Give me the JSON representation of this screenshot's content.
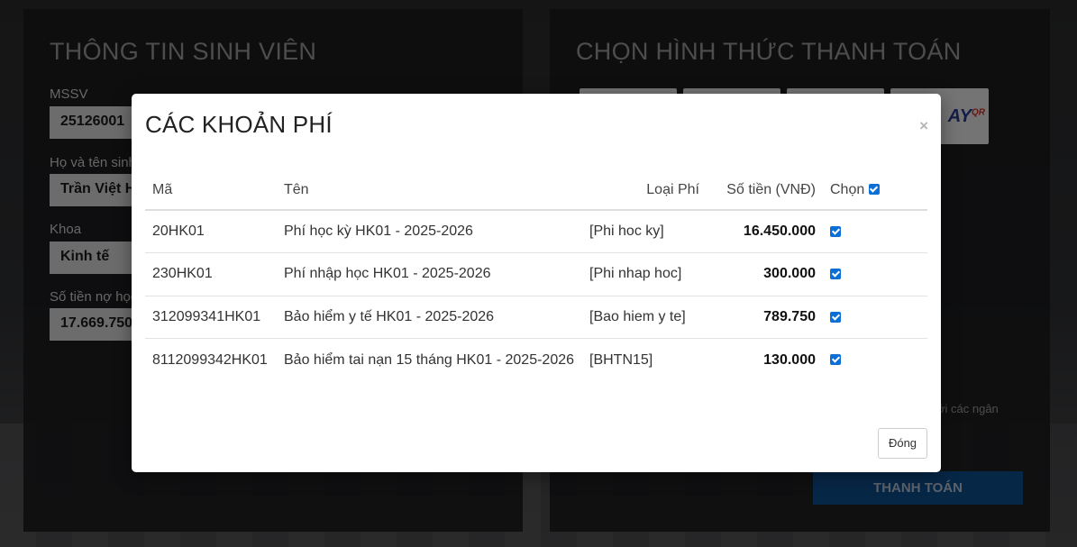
{
  "student_panel": {
    "title": "THÔNG TIN SINH VIÊN",
    "fields": [
      {
        "label": "MSSV",
        "value": "25126001"
      },
      {
        "label": "Họ và tên sinh",
        "value": "Trần Việt H"
      },
      {
        "label": "Khoa",
        "value": "Kinh tế"
      },
      {
        "label": "Số tiền nợ học",
        "value": "17.669.750"
      }
    ]
  },
  "payment_panel": {
    "title": "CHỌN HÌNH THỨC THANH TOÁN",
    "logo_text": "AY",
    "logo_sup": "QR",
    "bank_note": "ới các ngân",
    "pay_button": "THANH TOÁN"
  },
  "modal": {
    "title": "CÁC KHOẢN PHÍ",
    "close_symbol": "×",
    "columns": {
      "code": "Mã",
      "name": "Tên",
      "type": "Loại Phí",
      "amount": "Số tiền (VNĐ)",
      "select": "Chọn"
    },
    "rows": [
      {
        "code": "20HK01",
        "name": "Phí học kỳ HK01 - 2025-2026",
        "type": "[Phi hoc ky]",
        "amount": "16.450.000",
        "checked": true
      },
      {
        "code": "230HK01",
        "name": "Phí nhập học HK01 - 2025-2026",
        "type": "[Phi nhap hoc]",
        "amount": "300.000",
        "checked": true
      },
      {
        "code": "312099341HK01",
        "name": "Bảo hiểm y tế HK01 - 2025-2026",
        "type": "[Bao hiem y te]",
        "amount": "789.750",
        "checked": true
      },
      {
        "code": "8112099342HK01",
        "name": "Bảo hiểm tai nạn 15 tháng HK01 - 2025-2026",
        "type": "[BHTN15]",
        "amount": "130.000",
        "checked": true
      }
    ],
    "close_button": "Đóng"
  },
  "colors": {
    "accent_checkbox": "#0b6fd8",
    "pay_button": "#0f4e8f"
  }
}
